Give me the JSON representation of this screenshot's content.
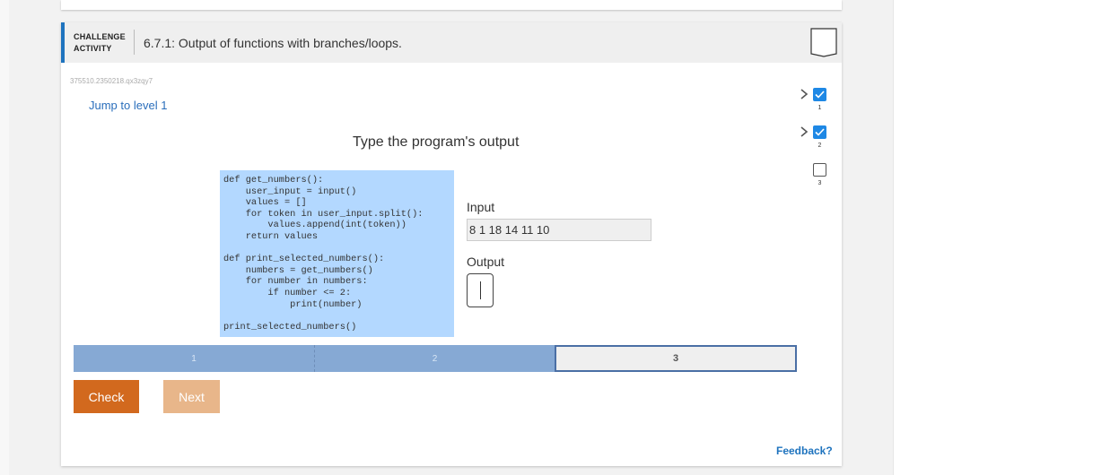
{
  "header": {
    "category_line1": "CHALLENGE",
    "category_line2": "ACTIVITY",
    "title": "6.7.1: Output of functions with branches/loops."
  },
  "activity_id": "375510.2350218.qx3zqy7",
  "jump_link": "Jump to level 1",
  "prompt": "Type the program's output",
  "code_lines": [
    "def get_numbers():",
    "    user_input = input()",
    "    values = []",
    "    for token in user_input.split():",
    "        values.append(int(token))",
    "    return values",
    "",
    "def print_selected_numbers():",
    "    numbers = get_numbers()",
    "    for number in numbers:",
    "        if number <= 2:",
    "            print(number)",
    "",
    "print_selected_numbers()"
  ],
  "input_section": {
    "label": "Input",
    "value": "8 1 18 14 11 10"
  },
  "output_section": {
    "label": "Output",
    "value": ""
  },
  "progress": {
    "segments": [
      {
        "label": "1",
        "state": "complete"
      },
      {
        "label": "2",
        "state": "complete"
      },
      {
        "label": "3",
        "state": "current"
      }
    ]
  },
  "buttons": {
    "check": "Check",
    "next": "Next"
  },
  "feedback": "Feedback?",
  "levels": [
    {
      "number": "1",
      "completed": true
    },
    {
      "number": "2",
      "completed": true
    },
    {
      "number": "3",
      "completed": false
    }
  ],
  "colors": {
    "accent_blue": "#1e73be",
    "code_bg": "#b3d8ff",
    "check_button": "#d2691e",
    "next_button_disabled": "#e8b68a",
    "progress_fill": "#86a9d4"
  }
}
